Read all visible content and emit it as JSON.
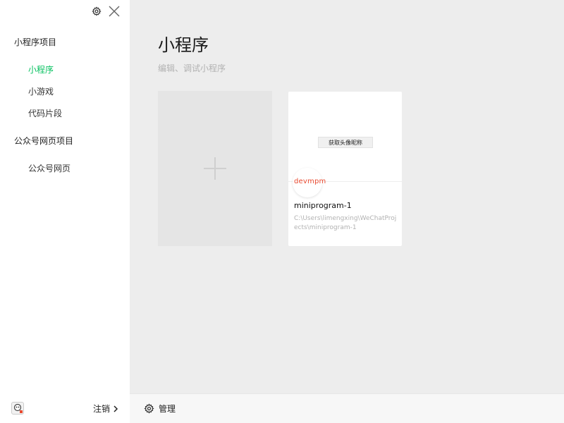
{
  "sidebar": {
    "top_icons": [
      "gear-icon",
      "close-icon"
    ],
    "sections": [
      {
        "title": "小程序项目",
        "items": [
          "小程序",
          "小游戏",
          "代码片段"
        ]
      },
      {
        "title": "公众号网页项目",
        "items": [
          "公众号网页"
        ]
      }
    ],
    "active_item": "小程序",
    "footer": {
      "logout_label": "注销"
    }
  },
  "main": {
    "title": "小程序",
    "subtitle": "编辑、调试小程序",
    "projects": [
      {
        "preview_button": "获取头像昵称",
        "badge": "devmpm",
        "name": "miniprogram-1",
        "path": "C:\\Users\\limengxing\\WeChatProjects\\miniprogram-1"
      }
    ]
  },
  "bottom_bar": {
    "manage_label": "管理"
  },
  "colors": {
    "accent": "#07c160",
    "sidebar_bg": "#ffffff",
    "main_bg": "#ededed",
    "badge": "#e8492f"
  }
}
